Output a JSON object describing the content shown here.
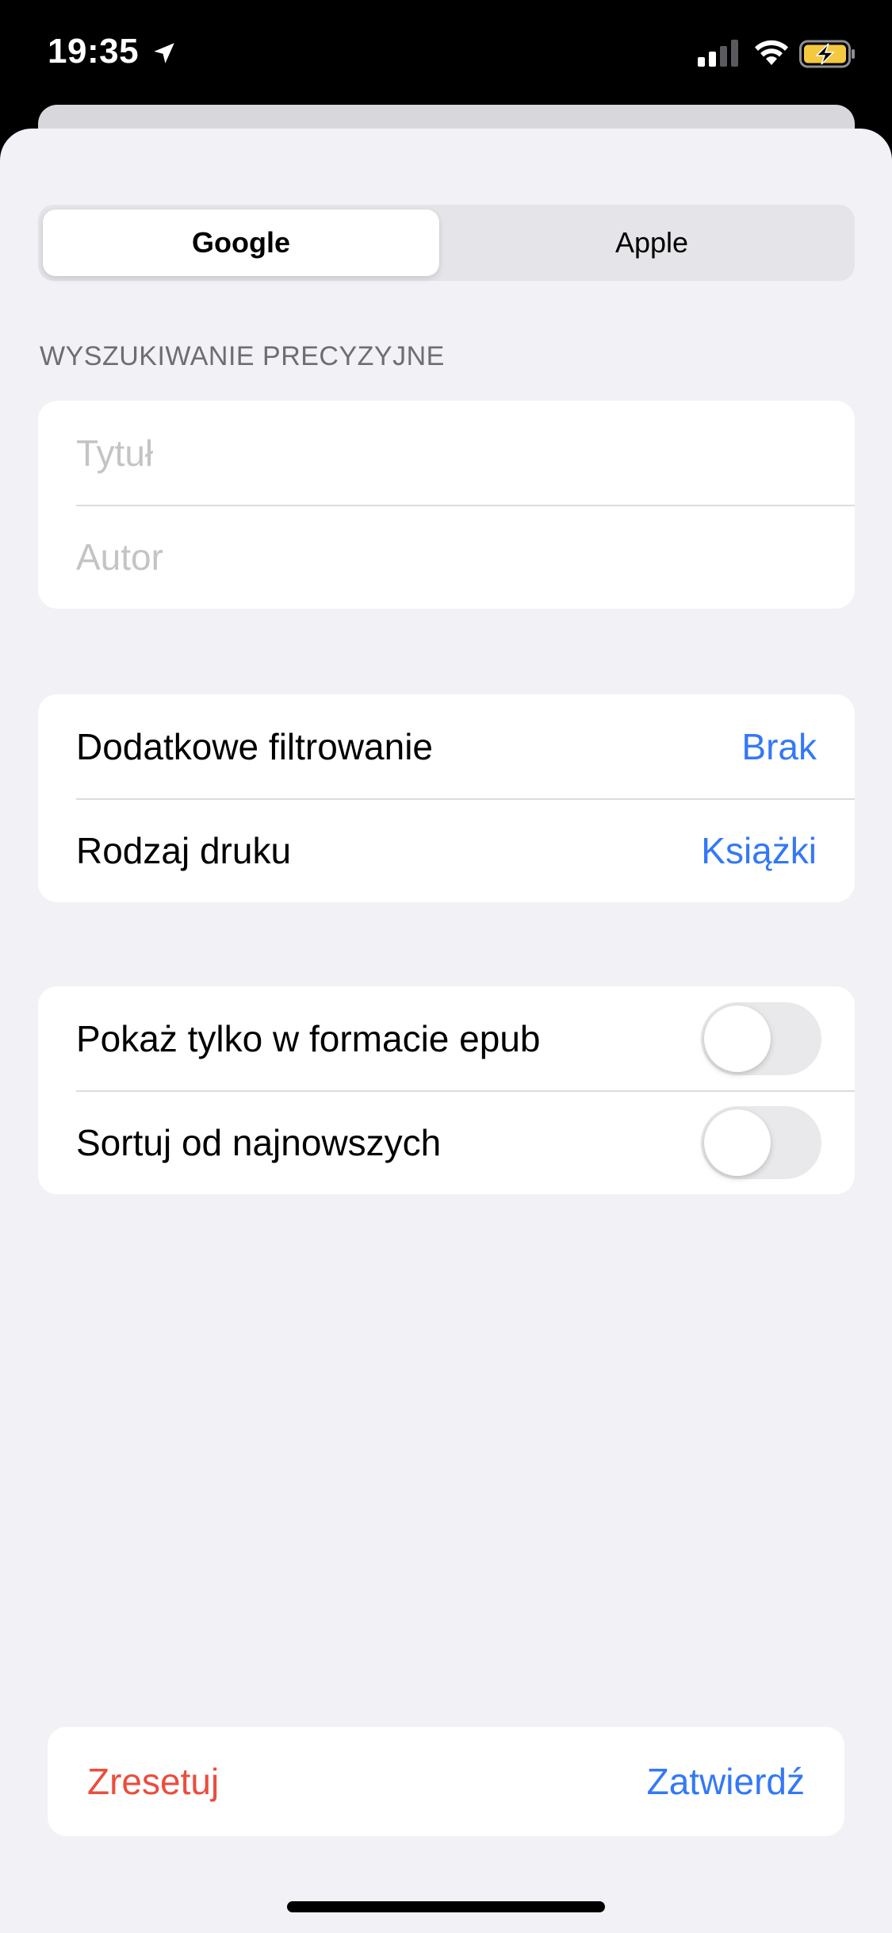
{
  "status_bar": {
    "time": "19:35",
    "icons": [
      "location-arrow-icon",
      "cellular-signal-icon",
      "wifi-icon",
      "battery-charging-icon"
    ],
    "battery_color": "#f5c842"
  },
  "segmented_control": {
    "options": [
      "Google",
      "Apple"
    ],
    "selected": "Google"
  },
  "precise_search": {
    "header": "WYSZUKIWANIE PRECYZYJNE",
    "title_placeholder": "Tytuł",
    "title_value": "",
    "author_placeholder": "Autor",
    "author_value": ""
  },
  "filters": {
    "extra_filter_label": "Dodatkowe filtrowanie",
    "extra_filter_value": "Brak",
    "print_type_label": "Rodzaj druku",
    "print_type_value": "Książki"
  },
  "toggles": {
    "epub_only_label": "Pokaż tylko w formacie epub",
    "epub_only_on": false,
    "newest_first_label": "Sortuj od najnowszych",
    "newest_first_on": false
  },
  "actions": {
    "reset_label": "Zresetuj",
    "confirm_label": "Zatwierdź"
  },
  "colors": {
    "accent_blue": "#3478f6",
    "destructive_red": "#eb4d3d",
    "background": "#f1f1f6"
  }
}
